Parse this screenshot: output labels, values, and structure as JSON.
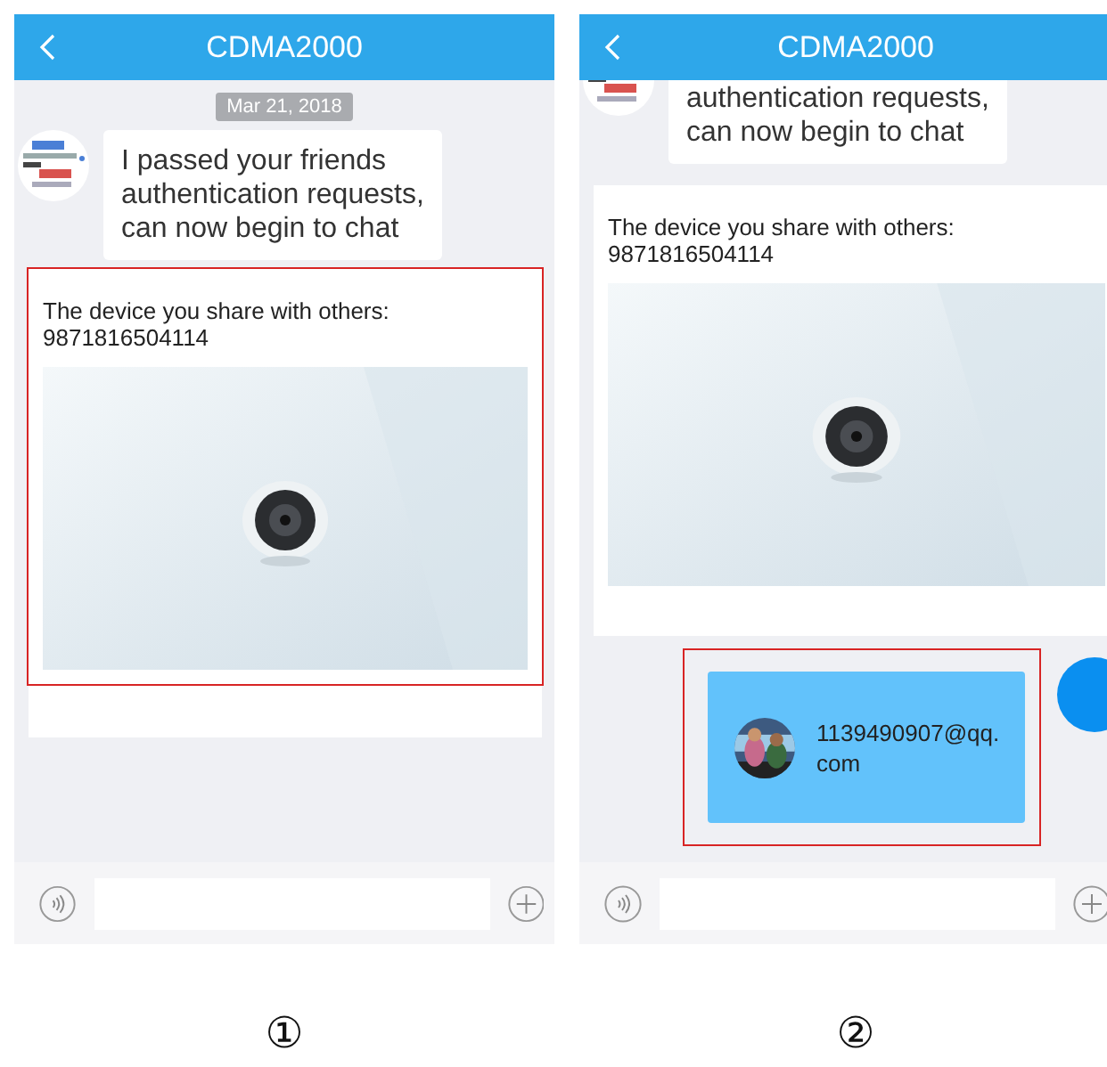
{
  "panels": [
    {
      "number": "①",
      "header": {
        "title": "CDMA2000"
      },
      "messages": [
        {
          "kind": "date",
          "text": "Mar 21, 2018"
        },
        {
          "kind": "text",
          "text": "I passed your friends authentication requests, can now begin to chat",
          "cut_top": false
        },
        {
          "kind": "device",
          "text": "The device you share with others:",
          "device_id": "9871816504114",
          "highlighted": true
        }
      ]
    },
    {
      "number": "②",
      "header": {
        "title": "CDMA2000"
      },
      "messages": [
        {
          "kind": "text",
          "text": "authentication requests,\ncan now begin to chat",
          "cut_top": true
        },
        {
          "kind": "device",
          "text": "The device you share with others:",
          "device_id": "9871816504114",
          "highlighted": false
        },
        {
          "kind": "contact",
          "text": "1139490907@qq.com",
          "highlighted": true
        }
      ]
    }
  ]
}
